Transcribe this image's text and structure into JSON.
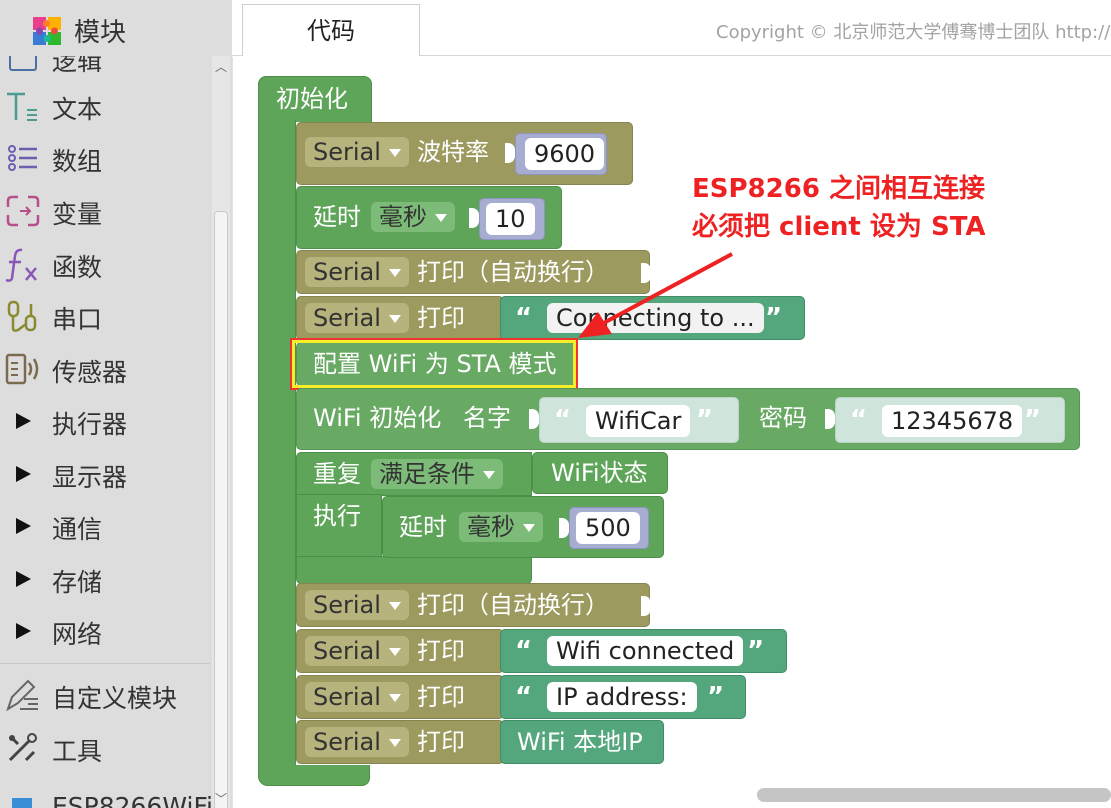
{
  "sidebar": {
    "title": "模块",
    "partial_top_label": "逻辑",
    "partial_bottom_label": "ESP8266WiFi",
    "items": [
      {
        "label": "文本",
        "icon": "text-icon"
      },
      {
        "label": "数组",
        "icon": "list-icon"
      },
      {
        "label": "变量",
        "icon": "variable-icon"
      },
      {
        "label": "函数",
        "icon": "function-icon"
      },
      {
        "label": "串口",
        "icon": "serial-port-icon"
      },
      {
        "label": "传感器",
        "icon": "sensor-icon"
      },
      {
        "label": "执行器",
        "icon": "expand-triangle-icon"
      },
      {
        "label": "显示器",
        "icon": "expand-triangle-icon"
      },
      {
        "label": "通信",
        "icon": "expand-triangle-icon"
      },
      {
        "label": "存储",
        "icon": "expand-triangle-icon"
      },
      {
        "label": "网络",
        "icon": "expand-triangle-icon"
      },
      {
        "label": "自定义模块",
        "icon": "custom-module-icon"
      },
      {
        "label": "工具",
        "icon": "tools-icon"
      }
    ]
  },
  "header": {
    "tab_code": "代码",
    "copyright": "Copyright © 北京师范大学傅骞博士团队 http://m"
  },
  "blocks": {
    "init_label": "初始化",
    "serial": "Serial",
    "baud_label": "波特率",
    "baud_value": "9600",
    "delay_label": "延时",
    "delay_unit": "毫秒",
    "delay_value_1": "10",
    "print_label": "打印",
    "println_label": "打印（自动换行）",
    "connecting_text": "Connecting to ...",
    "sta_mode": "配置 WiFi 为 STA 模式",
    "wifi_init_label": "WiFi 初始化",
    "name_label": "名字",
    "ssid": "WifiCar",
    "password_label": "密码",
    "password": "12345678",
    "repeat_label": "重复",
    "repeat_mode": "满足条件",
    "wifi_status": "WiFi状态",
    "do_label": "执行",
    "delay_value_2": "500",
    "connected_text": "Wifi connected",
    "ip_label_text": "IP address:",
    "local_ip": "WiFi 本地IP",
    "quote_open": "“",
    "quote_close": "”"
  },
  "annotation": {
    "line1": "ESP8266 之间相互连接",
    "line2": "必须把 client 设为 STA"
  },
  "colors": {
    "serial_block": "#9c9a5f",
    "control_block": "#5ea55a",
    "text_block": "#54a67d",
    "number_block": "#a7acd1",
    "annotation": "#ee2222",
    "highlight_outer": "#ee3333",
    "highlight_inner": "#f5ef2a"
  }
}
